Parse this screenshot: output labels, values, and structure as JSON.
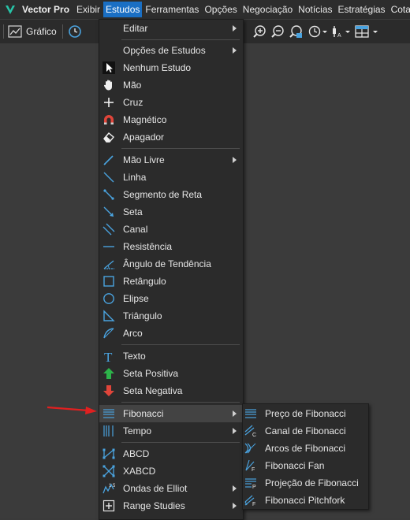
{
  "app": {
    "title": "Vector Pro"
  },
  "menubar": {
    "items": [
      "Exibir",
      "Estudos",
      "Ferramentas",
      "Opções",
      "Negociação",
      "Notícias",
      "Estratégias",
      "Cotações"
    ],
    "active": "Estudos"
  },
  "toolbar": {
    "grafico_label": "Gráfico"
  },
  "studies_menu": {
    "items": [
      {
        "label": "Editar",
        "icon": "none",
        "submenu": true
      },
      {
        "label": "Opções de Estudos",
        "icon": "none",
        "submenu": true
      },
      {
        "label": "Nenhum Estudo",
        "icon": "cursor-arrow-icon"
      },
      {
        "label": "Mão",
        "icon": "hand-icon"
      },
      {
        "label": "Cruz",
        "icon": "crosshair-icon"
      },
      {
        "label": "Magnético",
        "icon": "magnet-icon"
      },
      {
        "label": "Apagador",
        "icon": "eraser-icon"
      },
      {
        "label": "Mão Livre",
        "icon": "freehand-icon",
        "submenu": true
      },
      {
        "label": "Linha",
        "icon": "line-icon"
      },
      {
        "label": "Segmento de Reta",
        "icon": "segment-icon"
      },
      {
        "label": "Seta",
        "icon": "arrow-line-icon"
      },
      {
        "label": "Canal",
        "icon": "channel-icon"
      },
      {
        "label": "Resistência",
        "icon": "resistance-icon"
      },
      {
        "label": "Ângulo de Tendência",
        "icon": "trend-angle-icon"
      },
      {
        "label": "Retângulo",
        "icon": "rectangle-icon"
      },
      {
        "label": "Elipse",
        "icon": "ellipse-icon"
      },
      {
        "label": "Triângulo",
        "icon": "triangle-icon"
      },
      {
        "label": "Arco",
        "icon": "arc-icon"
      },
      {
        "label": "Texto",
        "icon": "text-icon"
      },
      {
        "label": "Seta Positiva",
        "icon": "arrow-up-green-icon"
      },
      {
        "label": "Seta Negativa",
        "icon": "arrow-down-red-icon"
      },
      {
        "label": "Fibonacci",
        "icon": "fibonacci-icon",
        "submenu": true,
        "highlighted": true
      },
      {
        "label": "Tempo",
        "icon": "time-lines-icon",
        "submenu": true
      },
      {
        "label": "ABCD",
        "icon": "abcd-icon"
      },
      {
        "label": "XABCD",
        "icon": "xabcd-icon"
      },
      {
        "label": "Ondas de Elliot",
        "icon": "elliot-waves-icon",
        "submenu": true
      },
      {
        "label": "Range Studies",
        "icon": "range-studies-icon",
        "submenu": true
      }
    ]
  },
  "fibonacci_submenu": {
    "items": [
      {
        "label": "Preço de Fibonacci",
        "icon": "fib-price-icon"
      },
      {
        "label": "Canal de Fibonacci",
        "icon": "fib-channel-icon"
      },
      {
        "label": "Arcos de Fibonacci",
        "icon": "fib-arcs-icon"
      },
      {
        "label": "Fibonacci Fan",
        "icon": "fib-fan-icon"
      },
      {
        "label": "Projeção de Fibonacci",
        "icon": "fib-projection-icon"
      },
      {
        "label": "Fibonacci Pitchfork",
        "icon": "fib-pitchfork-icon"
      }
    ]
  },
  "colors": {
    "accent": "#1a6fc4",
    "icon_blue": "#4aa3df",
    "green": "#2db34a",
    "red": "#e0453a",
    "logo": "#27c4a8"
  }
}
